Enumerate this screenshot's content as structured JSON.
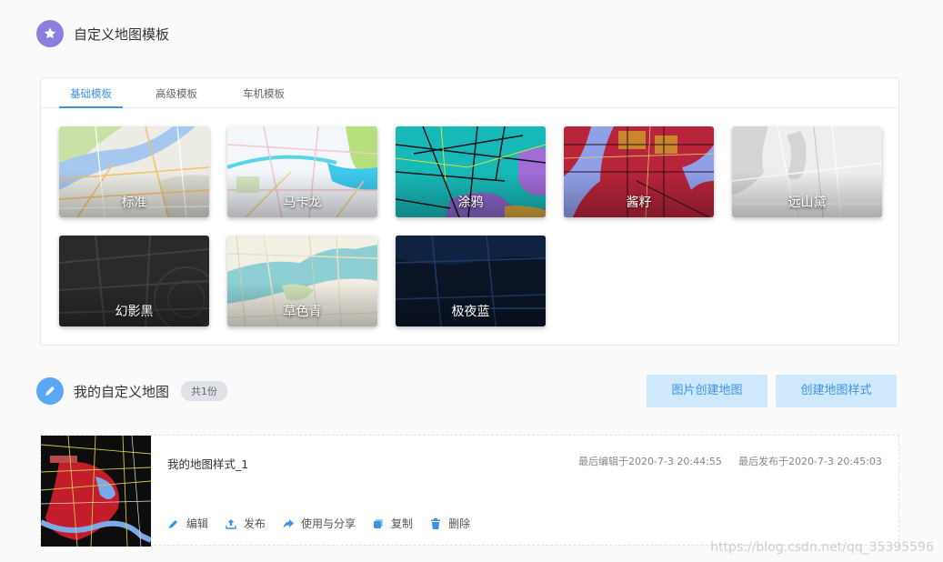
{
  "templates_section": {
    "title": "自定义地图模板",
    "icon": "star-icon",
    "icon_color": "#8a7fdc"
  },
  "tabs": [
    {
      "label": "基础模板",
      "active": true
    },
    {
      "label": "高级模板",
      "active": false
    },
    {
      "label": "车机模板",
      "active": false
    }
  ],
  "templates": [
    {
      "name": "标准"
    },
    {
      "name": "马卡龙"
    },
    {
      "name": "涂鸦"
    },
    {
      "name": "酱籽"
    },
    {
      "name": "远山黛"
    },
    {
      "name": "幻影黑"
    },
    {
      "name": "草色青"
    },
    {
      "name": "极夜蓝"
    }
  ],
  "my_maps": {
    "title": "我的自定义地图",
    "icon": "pencil-icon",
    "icon_color": "#3c92e6",
    "count_badge": "共1份",
    "create_from_image_label": "图片创建地图",
    "create_style_label": "创建地图样式",
    "accent_color": "#3c92e6"
  },
  "map_items": [
    {
      "name": "我的地图样式_1",
      "last_edited": "最后编辑于2020-7-3 20:44:55",
      "last_published": "最后发布于2020-7-3 20:45:03",
      "actions": {
        "edit": "编辑",
        "publish": "发布",
        "use_share": "使用与分享",
        "copy": "复制",
        "delete": "删除"
      }
    }
  ],
  "watermark": "https://blog.csdn.net/qq_35395596"
}
